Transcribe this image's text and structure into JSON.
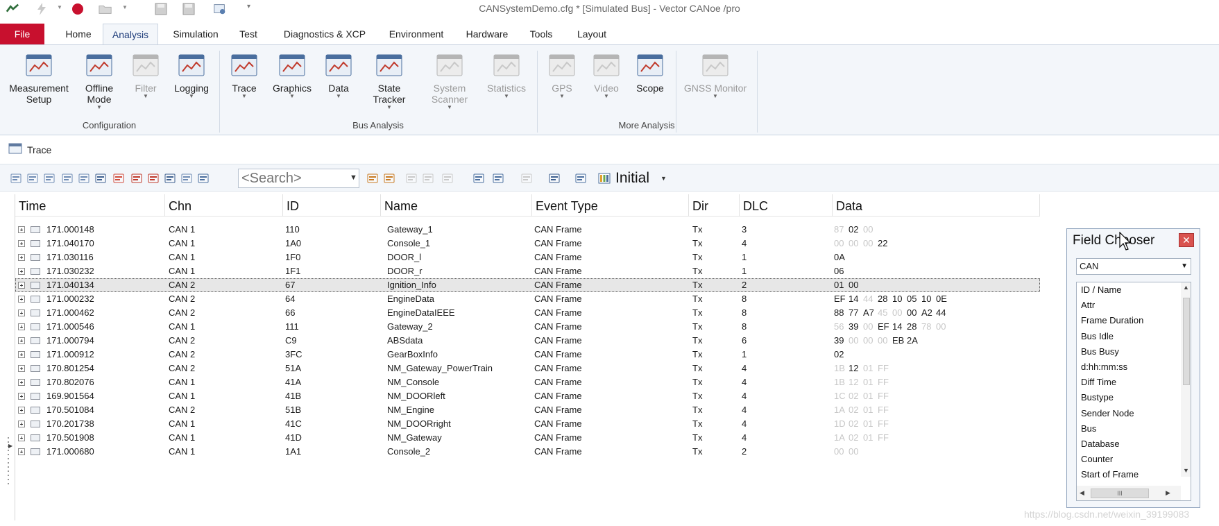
{
  "window": {
    "title": "CANSystemDemo.cfg * [Simulated Bus] - Vector CANoe /pro"
  },
  "menu": {
    "file": "File",
    "tabs": [
      "Home",
      "Analysis",
      "Simulation",
      "Test",
      "Diagnostics & XCP",
      "Environment",
      "Hardware",
      "Tools",
      "Layout"
    ],
    "active_tab": "Analysis"
  },
  "ribbon": {
    "buttons": [
      {
        "line1": "Measurement",
        "line2": "Setup",
        "enabled": true,
        "icon": "measurement-setup-icon"
      },
      {
        "line1": "Offline",
        "line2": "Mode",
        "enabled": true,
        "icon": "offline-mode-icon"
      },
      {
        "line1": "Filter",
        "line2": "",
        "enabled": false,
        "icon": "filter-icon"
      },
      {
        "line1": "Logging",
        "line2": "",
        "enabled": true,
        "icon": "logging-icon"
      },
      {
        "line1": "Trace",
        "line2": "",
        "enabled": true,
        "icon": "trace-icon"
      },
      {
        "line1": "Graphics",
        "line2": "",
        "enabled": true,
        "icon": "graphics-icon"
      },
      {
        "line1": "Data",
        "line2": "",
        "enabled": true,
        "icon": "data-icon"
      },
      {
        "line1": "State",
        "line2": "Tracker",
        "enabled": true,
        "icon": "state-tracker-icon"
      },
      {
        "line1": "System",
        "line2": "Scanner",
        "enabled": false,
        "icon": "system-scanner-icon"
      },
      {
        "line1": "Statistics",
        "line2": "",
        "enabled": false,
        "icon": "statistics-icon"
      },
      {
        "line1": "GPS",
        "line2": "",
        "enabled": false,
        "icon": "gps-icon"
      },
      {
        "line1": "Video",
        "line2": "",
        "enabled": false,
        "icon": "video-icon"
      },
      {
        "line1": "Scope",
        "line2": "",
        "enabled": true,
        "icon": "scope-icon"
      },
      {
        "line1": "GNSS Monitor",
        "line2": "",
        "enabled": false,
        "icon": "gnss-monitor-icon"
      }
    ],
    "groups": [
      "Configuration",
      "Bus Analysis",
      "More Analysis"
    ]
  },
  "trace": {
    "title": "Trace",
    "search_placeholder": "<Search>",
    "view_label": "Initial",
    "columns": [
      "Time",
      "Chn",
      "ID",
      "Name",
      "Event Type",
      "Dir",
      "DLC",
      "Data"
    ],
    "selected_row": 4,
    "rows": [
      {
        "time": "171.000148",
        "chn": "CAN 1",
        "id": "110",
        "name": "Gateway_1",
        "type": "CAN Frame",
        "dir": "Tx",
        "dlc": "3",
        "data": [
          [
            "87",
            true
          ],
          [
            "02",
            false
          ],
          [
            "00",
            true
          ]
        ]
      },
      {
        "time": "171.040170",
        "chn": "CAN 1",
        "id": "1A0",
        "name": "Console_1",
        "type": "CAN Frame",
        "dir": "Tx",
        "dlc": "4",
        "data": [
          [
            "00",
            true
          ],
          [
            "00",
            true
          ],
          [
            "00",
            true
          ],
          [
            "22",
            false
          ]
        ]
      },
      {
        "time": "171.030116",
        "chn": "CAN 1",
        "id": "1F0",
        "name": "DOOR_l",
        "type": "CAN Frame",
        "dir": "Tx",
        "dlc": "1",
        "data": [
          [
            "0A",
            false
          ]
        ]
      },
      {
        "time": "171.030232",
        "chn": "CAN 1",
        "id": "1F1",
        "name": "DOOR_r",
        "type": "CAN Frame",
        "dir": "Tx",
        "dlc": "1",
        "data": [
          [
            "06",
            false
          ]
        ]
      },
      {
        "time": "171.040134",
        "chn": "CAN 2",
        "id": "67",
        "name": "Ignition_Info",
        "type": "CAN Frame",
        "dir": "Tx",
        "dlc": "2",
        "data": [
          [
            "01",
            false
          ],
          [
            "00",
            false
          ]
        ]
      },
      {
        "time": "171.000232",
        "chn": "CAN 2",
        "id": "64",
        "name": "EngineData",
        "type": "CAN Frame",
        "dir": "Tx",
        "dlc": "8",
        "data": [
          [
            "EF",
            false
          ],
          [
            "14",
            false
          ],
          [
            "44",
            true
          ],
          [
            "28",
            false
          ],
          [
            "10",
            false
          ],
          [
            "05",
            false
          ],
          [
            "10",
            false
          ],
          [
            "0E",
            false
          ]
        ]
      },
      {
        "time": "171.000462",
        "chn": "CAN 2",
        "id": "66",
        "name": "EngineDataIEEE",
        "type": "CAN Frame",
        "dir": "Tx",
        "dlc": "8",
        "data": [
          [
            "88",
            false
          ],
          [
            "77",
            false
          ],
          [
            "A7",
            false
          ],
          [
            "45",
            true
          ],
          [
            "00",
            true
          ],
          [
            "00",
            false
          ],
          [
            "A2",
            false
          ],
          [
            "44",
            false
          ]
        ]
      },
      {
        "time": "171.000546",
        "chn": "CAN 1",
        "id": "111",
        "name": "Gateway_2",
        "type": "CAN Frame",
        "dir": "Tx",
        "dlc": "8",
        "data": [
          [
            "56",
            true
          ],
          [
            "39",
            false
          ],
          [
            "00",
            true
          ],
          [
            "EF",
            false
          ],
          [
            "14",
            false
          ],
          [
            "28",
            false
          ],
          [
            "78",
            true
          ],
          [
            "00",
            true
          ]
        ]
      },
      {
        "time": "171.000794",
        "chn": "CAN 2",
        "id": "C9",
        "name": "ABSdata",
        "type": "CAN Frame",
        "dir": "Tx",
        "dlc": "6",
        "data": [
          [
            "39",
            false
          ],
          [
            "00",
            true
          ],
          [
            "00",
            true
          ],
          [
            "00",
            true
          ],
          [
            "EB",
            false
          ],
          [
            "2A",
            false
          ]
        ]
      },
      {
        "time": "171.000912",
        "chn": "CAN 2",
        "id": "3FC",
        "name": "GearBoxInfo",
        "type": "CAN Frame",
        "dir": "Tx",
        "dlc": "1",
        "data": [
          [
            "02",
            false
          ]
        ]
      },
      {
        "time": "170.801254",
        "chn": "CAN 2",
        "id": "51A",
        "name": "NM_Gateway_PowerTrain",
        "type": "CAN Frame",
        "dir": "Tx",
        "dlc": "4",
        "data": [
          [
            "1B",
            true
          ],
          [
            "12",
            false
          ],
          [
            "01",
            true
          ],
          [
            "FF",
            true
          ]
        ]
      },
      {
        "time": "170.802076",
        "chn": "CAN 1",
        "id": "41A",
        "name": "NM_Console",
        "type": "CAN Frame",
        "dir": "Tx",
        "dlc": "4",
        "data": [
          [
            "1B",
            true
          ],
          [
            "12",
            true
          ],
          [
            "01",
            true
          ],
          [
            "FF",
            true
          ]
        ]
      },
      {
        "time": "169.901564",
        "chn": "CAN 1",
        "id": "41B",
        "name": "NM_DOORleft",
        "type": "CAN Frame",
        "dir": "Tx",
        "dlc": "4",
        "data": [
          [
            "1C",
            true
          ],
          [
            "02",
            true
          ],
          [
            "01",
            true
          ],
          [
            "FF",
            true
          ]
        ]
      },
      {
        "time": "170.501084",
        "chn": "CAN 2",
        "id": "51B",
        "name": "NM_Engine",
        "type": "CAN Frame",
        "dir": "Tx",
        "dlc": "4",
        "data": [
          [
            "1A",
            true
          ],
          [
            "02",
            true
          ],
          [
            "01",
            true
          ],
          [
            "FF",
            true
          ]
        ]
      },
      {
        "time": "170.201738",
        "chn": "CAN 1",
        "id": "41C",
        "name": "NM_DOORright",
        "type": "CAN Frame",
        "dir": "Tx",
        "dlc": "4",
        "data": [
          [
            "1D",
            true
          ],
          [
            "02",
            true
          ],
          [
            "01",
            true
          ],
          [
            "FF",
            true
          ]
        ]
      },
      {
        "time": "170.501908",
        "chn": "CAN 1",
        "id": "41D",
        "name": "NM_Gateway",
        "type": "CAN Frame",
        "dir": "Tx",
        "dlc": "4",
        "data": [
          [
            "1A",
            true
          ],
          [
            "02",
            true
          ],
          [
            "01",
            true
          ],
          [
            "FF",
            true
          ]
        ]
      },
      {
        "time": "171.000680",
        "chn": "CAN 1",
        "id": "1A1",
        "name": "Console_2",
        "type": "CAN Frame",
        "dir": "Tx",
        "dlc": "2",
        "data": [
          [
            "00",
            true
          ],
          [
            "00",
            true
          ]
        ]
      }
    ]
  },
  "field_chooser": {
    "title": "Field Chooser",
    "selected": "CAN",
    "items": [
      "ID / Name",
      "Attr",
      "Frame Duration",
      "Bus Idle",
      "Bus Busy",
      "d:hh:mm:ss",
      "Diff Time",
      "Bustype",
      "Sender Node",
      "Bus",
      "Database",
      "Counter",
      "Start of Frame"
    ],
    "hscroll_glyph": "III"
  },
  "watermark": "https://blog.csdn.net/weixin_39199083",
  "colors": {
    "file_tab": "#c8102e",
    "ribbon_bg": "#f3f6fa",
    "accent": "#1f3d7a",
    "selection": "#e7e7e7"
  }
}
